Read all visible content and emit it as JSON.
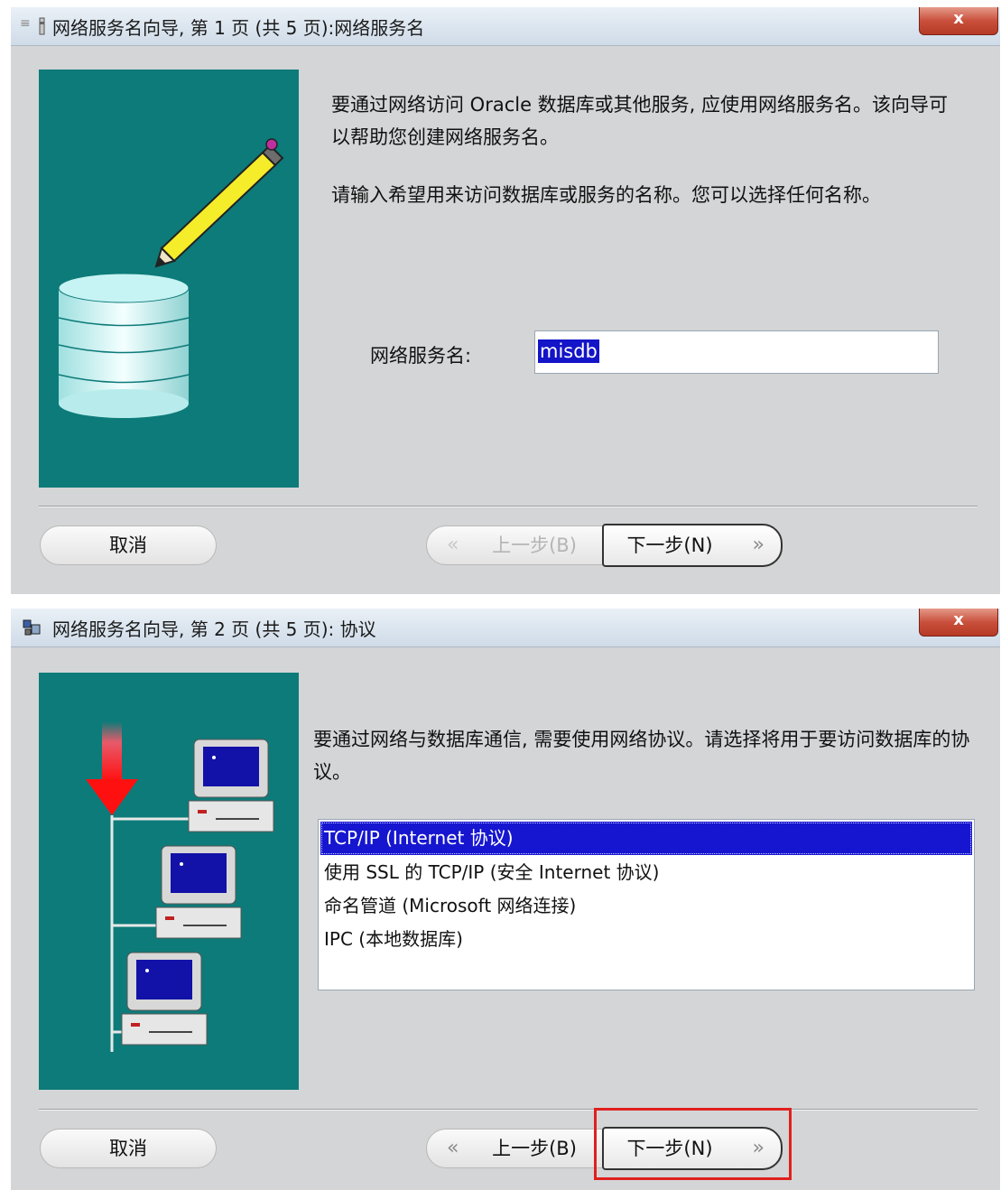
{
  "dialog1": {
    "title": "网络服务名向导, 第 1 页 (共 5 页):网络服务名",
    "close_label": "x",
    "intro_text": "要通过网络访问 Oracle 数据库或其他服务, 应使用网络服务名。该向导可以帮助您创建网络服务名。",
    "prompt_text": "请输入希望用来访问数据库或服务的名称。您可以选择任何名称。",
    "field_label": "网络服务名:",
    "field_value": "misdb",
    "cancel_label": "取消",
    "back_label": "上一步(B)",
    "next_label": "下一步(N)",
    "back_enabled": false
  },
  "dialog2": {
    "title": "网络服务名向导, 第 2 页 (共 5 页): 协议",
    "close_label": "x",
    "intro_text": "要通过网络与数据库通信, 需要使用网络协议。请选择将用于要访问数据库的协议。",
    "protocols": [
      {
        "label": "TCP/IP (Internet 协议)",
        "selected": true
      },
      {
        "label": "使用 SSL 的 TCP/IP (安全 Internet 协议)",
        "selected": false
      },
      {
        "label": "命名管道 (Microsoft 网络连接)",
        "selected": false
      },
      {
        "label": "IPC (本地数据库)",
        "selected": false
      }
    ],
    "cancel_label": "取消",
    "back_label": "上一步(B)",
    "next_label": "下一步(N)",
    "back_enabled": true,
    "next_highlighted": true
  },
  "icons": {
    "dialog1_illustration": [
      "pencil-icon",
      "database-cylinder-icon"
    ],
    "dialog2_illustration": [
      "red-down-arrow-icon",
      "network-computer-icon"
    ],
    "back_chevron": "«",
    "next_chevron": "»"
  },
  "colors": {
    "illustration_bg": "#0d7b79",
    "selection": "#1616d0",
    "highlight": "#e02020"
  }
}
